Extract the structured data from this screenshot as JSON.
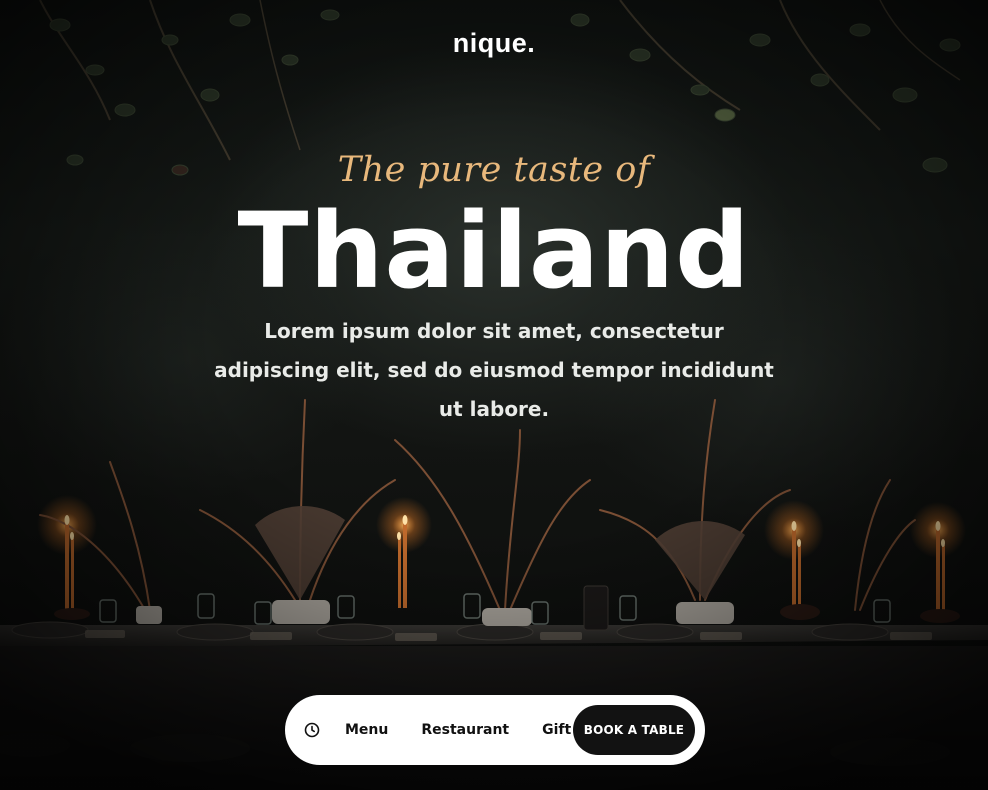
{
  "brand": {
    "logo": "nique."
  },
  "hero": {
    "tagline": "The pure taste of",
    "headline": "Thailand",
    "description": "Lorem ipsum dolor sit amet, consectetur adipiscing elit, sed do eiusmod tempor incididunt ut labore."
  },
  "nav": {
    "icon": "clock-icon",
    "items": [
      {
        "label": "Menu"
      },
      {
        "label": "Restaurant"
      },
      {
        "label": "Gift"
      }
    ],
    "cta": "BOOK A TABLE"
  },
  "colors": {
    "accent": "#e8b87c",
    "background": "#0b0c0b",
    "nav_bg": "#ffffff",
    "cta_bg": "#121212"
  }
}
